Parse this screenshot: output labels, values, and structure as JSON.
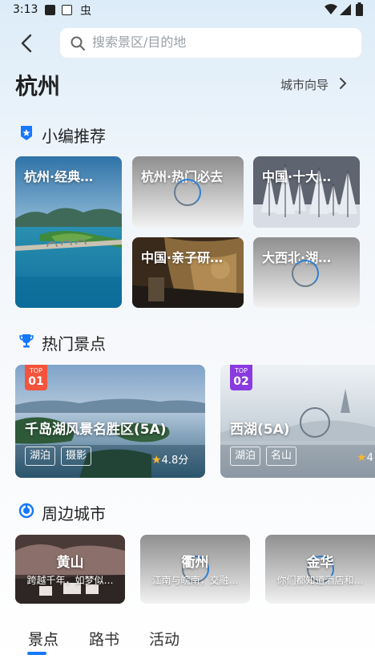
{
  "status_bar": {
    "time": "3:13"
  },
  "header": {
    "search_placeholder": "搜索景区/目的地"
  },
  "city": {
    "name": "杭州",
    "guide_label": "城市向导"
  },
  "editor_picks": {
    "title": "小编推荐",
    "items": [
      {
        "title": "杭州·经典…"
      },
      {
        "title": "杭州·热门必去"
      },
      {
        "title": "中国·十大…"
      },
      {
        "title": "中国·亲子研…"
      },
      {
        "title": "大西北·湖…"
      }
    ]
  },
  "hot_spots": {
    "title": "热门景点",
    "items": [
      {
        "top_label": "TOP",
        "rank": "01",
        "name": "千岛湖风景名胜区(5A)",
        "tags": [
          "湖泊",
          "摄影"
        ],
        "rating": "4.8分"
      },
      {
        "top_label": "TOP",
        "rank": "02",
        "name": "西湖(5A)",
        "tags": [
          "湖泊",
          "名山"
        ],
        "rating": "4"
      }
    ]
  },
  "nearby": {
    "title": "周边城市",
    "items": [
      {
        "name": "黄山",
        "desc": "跨越千年，如梦似…"
      },
      {
        "name": "衢州",
        "desc": "江南与皖南，交融…"
      },
      {
        "name": "金华",
        "desc": "你们都知道酒店和…"
      }
    ]
  },
  "bottom_tabs": [
    {
      "label": "景点",
      "active": true
    },
    {
      "label": "路书",
      "active": false
    },
    {
      "label": "活动",
      "active": false
    }
  ],
  "colors": {
    "accent": "#1677ff",
    "top1": "#f4533c",
    "top2": "#8a3be0"
  }
}
